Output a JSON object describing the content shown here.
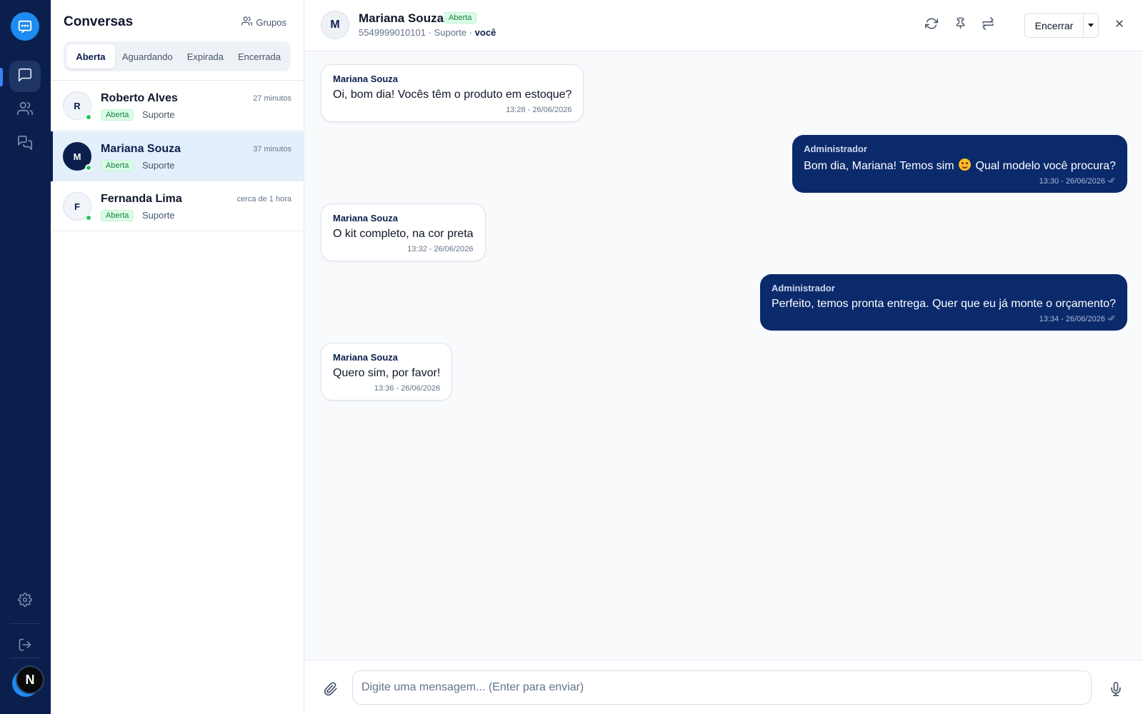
{
  "list": {
    "title": "Conversas",
    "groups_label": "Grupos",
    "tabs": [
      {
        "label": "Aberta"
      },
      {
        "label": "Aguardando"
      },
      {
        "label": "Expirada"
      },
      {
        "label": "Encerrada"
      }
    ],
    "conversations": [
      {
        "initial": "R",
        "name": "Roberto Alves",
        "time": "27 minutos",
        "status": "Aberta",
        "department": "Suporte"
      },
      {
        "initial": "M",
        "name": "Mariana Souza",
        "time": "37 minutos",
        "status": "Aberta",
        "department": "Suporte"
      },
      {
        "initial": "F",
        "name": "Fernanda Lima",
        "time": "cerca de 1 hora",
        "status": "Aberta",
        "department": "Suporte"
      }
    ]
  },
  "rail": {
    "avatar_letter": "N"
  },
  "header": {
    "initial": "M",
    "name": "Mariana Souza",
    "status": "Aberta",
    "phone": "5549999010101",
    "department": "Suporte",
    "assignee": "você",
    "end_label": "Encerrar"
  },
  "messages": [
    {
      "direction": "in",
      "author": "Mariana Souza",
      "text": "Oi, bom dia! Vocês têm o produto em estoque?",
      "time": "13:28 - 26/06/2026"
    },
    {
      "direction": "out",
      "author": "Administrador",
      "text_before": "Bom dia, Mariana! Temos sim",
      "emoji": "smiling-face",
      "text_after": "Qual modelo você procura?",
      "time": "13:30 - 26/06/2026"
    },
    {
      "direction": "in",
      "author": "Mariana Souza",
      "text": "O kit completo, na cor preta",
      "time": "13:32 - 26/06/2026"
    },
    {
      "direction": "out",
      "author": "Administrador",
      "text": "Perfeito, temos pronta entrega. Quer que eu já monte o orçamento?",
      "time": "13:34 - 26/06/2026"
    },
    {
      "direction": "in",
      "author": "Mariana Souza",
      "text": "Quero sim, por favor!",
      "time": "13:36 - 26/06/2026"
    }
  ],
  "composer": {
    "placeholder": "Digite uma mensagem... (Enter para enviar)"
  },
  "colors": {
    "rail": "#0b1f4d",
    "accent": "#1d8bf0",
    "outgoing_bubble": "#0b2a6b",
    "status_green": "#22c55e"
  }
}
